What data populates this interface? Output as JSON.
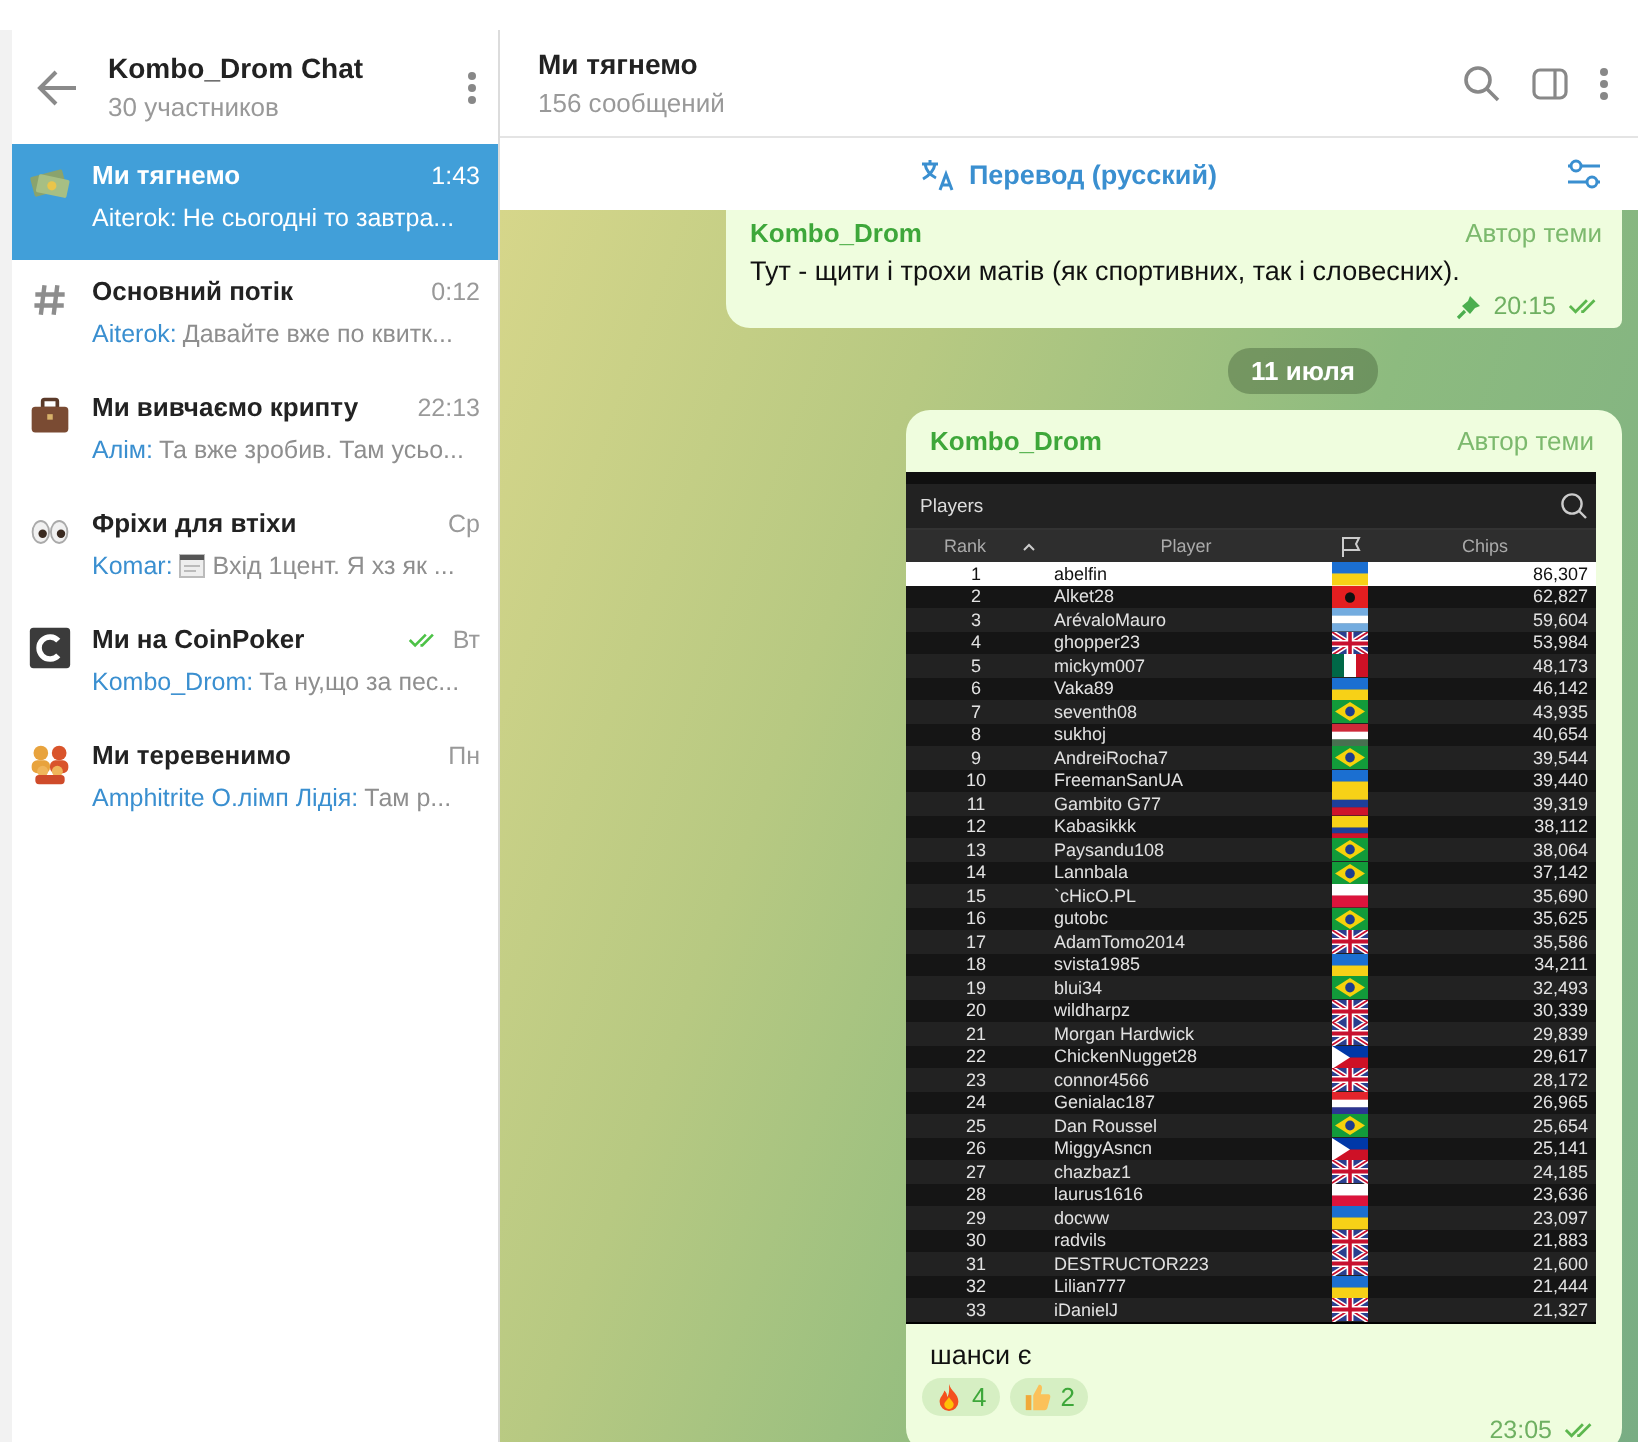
{
  "sidebar": {
    "title": "Kombo_Drom Chat",
    "subtitle": "30 участников",
    "chats": [
      {
        "kind": "money",
        "name": "Ми тягнемо",
        "time": "1:43",
        "sender": "Aiterok:",
        "preview": "Не сьогодні то завтра...",
        "attachment": false,
        "read_ticks": false,
        "selected": true
      },
      {
        "kind": "hash",
        "name": "Основний потік",
        "time": "0:12",
        "sender": "Aiterok:",
        "preview": "Давайте вже по квитк...",
        "attachment": false,
        "read_ticks": false,
        "selected": false
      },
      {
        "kind": "briefcase",
        "name": "Ми вивчаємо крипту",
        "time": "22:13",
        "sender": "Алім:",
        "preview": "Та вже зробив. Там усьо...",
        "attachment": false,
        "read_ticks": false,
        "selected": false
      },
      {
        "kind": "eyes",
        "name": "Фріхи для втіхи",
        "time": "Ср",
        "sender": "Komar:",
        "preview": "Вхід 1цент. Я хз як ...",
        "attachment": true,
        "read_ticks": false,
        "selected": false
      },
      {
        "kind": "letter-c",
        "name": "Ми на CoinPoker",
        "time": "Вт",
        "sender": "Kombo_Drom:",
        "preview": "Та ну,що за пес...",
        "attachment": false,
        "read_ticks": true,
        "selected": false
      },
      {
        "kind": "people",
        "name": "Ми теревенимо",
        "time": "Пн",
        "sender": "Amphitrite О.лімп Лідія:",
        "preview": "Там р...",
        "attachment": false,
        "read_ticks": false,
        "selected": false
      }
    ]
  },
  "chat": {
    "title": "Ми тягнемо",
    "subtitle": "156 сообщений",
    "translate": "Перевод (русский)",
    "messages": [
      {
        "kind": "text",
        "author": "Kombo_Drom",
        "badge": "Автор теми",
        "text": "Тут - щити і трохи матів (як спортивних, так і словесних).",
        "pinned": true,
        "time": "20:15"
      },
      {
        "kind": "date",
        "text": "11 июля"
      },
      {
        "kind": "table",
        "author": "Kombo_Drom",
        "badge": "Автор теми",
        "table": {
          "title": "Players",
          "columns": [
            "Rank",
            "Player",
            "Chips"
          ],
          "rows": [
            {
              "rank": "1",
              "player": "abelfin",
              "kind": "ua",
              "chips": "86,307",
              "selected": true
            },
            {
              "rank": "2",
              "player": "Alket28",
              "kind": "al",
              "chips": "62,827",
              "selected": false
            },
            {
              "rank": "3",
              "player": "ArévaloMauro",
              "kind": "ar",
              "chips": "59,604",
              "selected": false
            },
            {
              "rank": "4",
              "player": "ghopper23",
              "kind": "gb",
              "chips": "53,984",
              "selected": false
            },
            {
              "rank": "5",
              "player": "mickym007",
              "kind": "mx",
              "chips": "48,173",
              "selected": false
            },
            {
              "rank": "6",
              "player": "Vaka89",
              "kind": "ua",
              "chips": "46,142",
              "selected": false
            },
            {
              "rank": "7",
              "player": "seventh08",
              "kind": "br",
              "chips": "43,935",
              "selected": false
            },
            {
              "rank": "8",
              "player": "sukhoj",
              "kind": "hu",
              "chips": "40,654",
              "selected": false
            },
            {
              "rank": "9",
              "player": "AndreiRocha7",
              "kind": "br",
              "chips": "39,544",
              "selected": false
            },
            {
              "rank": "10",
              "player": "FreemanSanUA",
              "kind": "ua",
              "chips": "39,440",
              "selected": false
            },
            {
              "rank": "11",
              "player": "Gambito G77",
              "kind": "ve",
              "chips": "39,319",
              "selected": false
            },
            {
              "rank": "12",
              "player": "Kabasikkk",
              "kind": "co",
              "chips": "38,112",
              "selected": false
            },
            {
              "rank": "13",
              "player": "Paysandu108",
              "kind": "br",
              "chips": "38,064",
              "selected": false
            },
            {
              "rank": "14",
              "player": "Lannbala",
              "kind": "br",
              "chips": "37,142",
              "selected": false
            },
            {
              "rank": "15",
              "player": "`cHicO.PL",
              "kind": "pl",
              "chips": "35,690",
              "selected": false
            },
            {
              "rank": "16",
              "player": "gutobc",
              "kind": "br",
              "chips": "35,625",
              "selected": false
            },
            {
              "rank": "17",
              "player": "AdamTomo2014",
              "kind": "gb",
              "chips": "35,586",
              "selected": false
            },
            {
              "rank": "18",
              "player": "svista1985",
              "kind": "ua",
              "chips": "34,211",
              "selected": false
            },
            {
              "rank": "19",
              "player": "blui34",
              "kind": "br",
              "chips": "32,493",
              "selected": false
            },
            {
              "rank": "20",
              "player": "wildharpz",
              "kind": "gb",
              "chips": "30,339",
              "selected": false
            },
            {
              "rank": "21",
              "player": "Morgan Hardwick",
              "kind": "gb",
              "chips": "29,839",
              "selected": false
            },
            {
              "rank": "22",
              "player": "ChickenNugget28",
              "kind": "ph",
              "chips": "29,617",
              "selected": false
            },
            {
              "rank": "23",
              "player": "connor4566",
              "kind": "gb",
              "chips": "28,172",
              "selected": false
            },
            {
              "rank": "24",
              "player": "Genialac187",
              "kind": "hr",
              "chips": "26,965",
              "selected": false
            },
            {
              "rank": "25",
              "player": "Dan Roussel",
              "kind": "br",
              "chips": "25,654",
              "selected": false
            },
            {
              "rank": "26",
              "player": "MiggyAsncn",
              "kind": "ph",
              "chips": "25,141",
              "selected": false
            },
            {
              "rank": "27",
              "player": "chazbaz1",
              "kind": "gb",
              "chips": "24,185",
              "selected": false
            },
            {
              "rank": "28",
              "player": "laurus1616",
              "kind": "pl",
              "chips": "23,636",
              "selected": false
            },
            {
              "rank": "29",
              "player": "docww",
              "kind": "ua",
              "chips": "23,097",
              "selected": false
            },
            {
              "rank": "30",
              "player": "radvils",
              "kind": "gb",
              "chips": "21,883",
              "selected": false
            },
            {
              "rank": "31",
              "player": "DESTRUCTOR223",
              "kind": "gb",
              "chips": "21,600",
              "selected": false
            },
            {
              "rank": "32",
              "player": "Lilian777",
              "kind": "ua",
              "chips": "21,444",
              "selected": false
            },
            {
              "rank": "33",
              "player": "iDanielJ",
              "kind": "gb",
              "chips": "21,327",
              "selected": false
            }
          ]
        },
        "text": "шанси є",
        "reactions": [
          {
            "kind": "fire",
            "count": "4"
          },
          {
            "kind": "thumbs-up",
            "count": "2"
          }
        ],
        "time": "23:05"
      }
    ]
  }
}
